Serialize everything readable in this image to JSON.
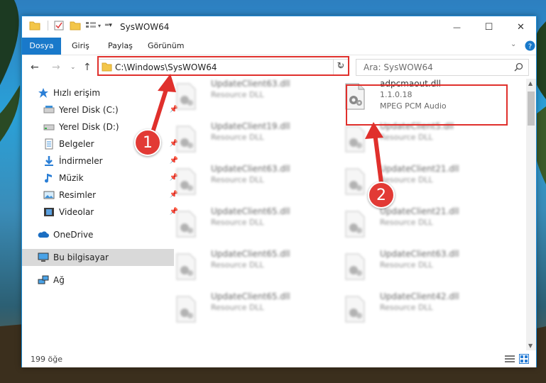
{
  "window": {
    "title": "SysWOW64",
    "controls": {
      "minimize": "—",
      "maximize": "☐",
      "close": "✕"
    }
  },
  "ribbon": {
    "tabs": [
      {
        "label": "Dosya",
        "active": true
      },
      {
        "label": "Giriş"
      },
      {
        "label": "Paylaş"
      },
      {
        "label": "Görünüm"
      }
    ]
  },
  "address": {
    "path": "C:\\Windows\\SysWOW64",
    "search_placeholder": "Ara: SysWOW64"
  },
  "sidebar": {
    "items": [
      {
        "label": "Hızlı erişim",
        "icon": "star-icon"
      },
      {
        "label": "Yerel Disk (C:)",
        "icon": "drive-icon",
        "pinned": true
      },
      {
        "label": "Yerel Disk (D:)",
        "icon": "drive-icon"
      },
      {
        "label": "Belgeler",
        "icon": "documents-icon",
        "pinned": true
      },
      {
        "label": "İndirmeler",
        "icon": "download-icon",
        "pinned": true
      },
      {
        "label": "Müzik",
        "icon": "music-icon",
        "pinned": true
      },
      {
        "label": "Resimler",
        "icon": "pictures-icon",
        "pinned": true
      },
      {
        "label": "Videolar",
        "icon": "videos-icon",
        "pinned": true
      },
      {
        "label": "OneDrive",
        "icon": "cloud-icon"
      },
      {
        "label": "Bu bilgisayar",
        "icon": "computer-icon",
        "selected": true
      },
      {
        "label": "Ağ",
        "icon": "network-icon"
      }
    ]
  },
  "files": {
    "left": [
      {
        "name": "UpdateClient63.dll",
        "desc": "Resource DLL"
      },
      {
        "name": "UpdateClient19.dll",
        "desc": "Resource DLL"
      },
      {
        "name": "UpdateClient63.dll",
        "desc": "Resource DLL"
      },
      {
        "name": "UpdateClient65.dll",
        "desc": "Resource DLL"
      },
      {
        "name": "UpdateClient65.dll",
        "desc": "Resource DLL"
      },
      {
        "name": "UpdateClient65.dll",
        "desc": "Resource DLL"
      }
    ],
    "right": [
      {
        "name": "adpcmaout.dll",
        "version": "1.1.0.18",
        "desc": "MPEG PCM Audio",
        "highlighted": true
      },
      {
        "name": "UpdateClient5.dll",
        "desc": "Resource DLL"
      },
      {
        "name": "UpdateClient21.dll",
        "desc": "Resource DLL"
      },
      {
        "name": "UpdateClient21.dll",
        "desc": "Resource DLL"
      },
      {
        "name": "UpdateClient63.dll",
        "desc": "Resource DLL"
      },
      {
        "name": "UpdateClient42.dll",
        "desc": "Resource DLL"
      }
    ]
  },
  "status": {
    "item_count": "199 öğe"
  },
  "callouts": [
    {
      "label": "1"
    },
    {
      "label": "2"
    }
  ],
  "colors": {
    "accent": "#1979ca",
    "highlight": "#e0302c"
  }
}
